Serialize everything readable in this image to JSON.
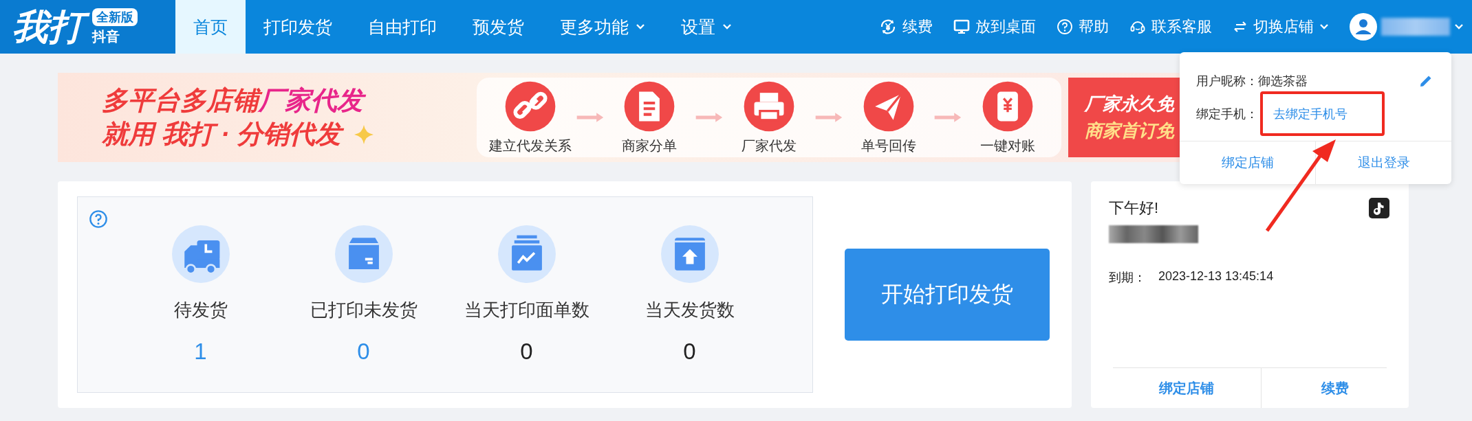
{
  "logo": {
    "title": "我打",
    "badge": "全新版",
    "subtitle": "抖音"
  },
  "nav": [
    {
      "label": "首页",
      "selected": true,
      "dropdown": false
    },
    {
      "label": "打印发货",
      "selected": false,
      "dropdown": false
    },
    {
      "label": "自由打印",
      "selected": false,
      "dropdown": false
    },
    {
      "label": "预发货",
      "selected": false,
      "dropdown": false
    },
    {
      "label": "更多功能",
      "selected": false,
      "dropdown": true
    },
    {
      "label": "设置",
      "selected": false,
      "dropdown": true
    }
  ],
  "toolbar": [
    {
      "label": "续费",
      "dropdown": false
    },
    {
      "label": "放到桌面",
      "dropdown": false
    },
    {
      "label": "帮助",
      "dropdown": false
    },
    {
      "label": "联系客服",
      "dropdown": false
    },
    {
      "label": "切换店铺",
      "dropdown": true
    }
  ],
  "banner": {
    "headline": [
      {
        "text": "多平台多店铺",
        "kind": "primary"
      },
      {
        "text": "厂家代发",
        "kind": "accent"
      }
    ],
    "tagline": "就用 我打 · 分销代发",
    "steps": [
      "建立代发关系",
      "商家分单",
      "厂家代发",
      "单号回传",
      "一键对账"
    ],
    "promo": [
      "厂家永久免",
      "商家首订免"
    ]
  },
  "stats": [
    {
      "label": "待发货",
      "value": "1",
      "kind": "link"
    },
    {
      "label": "已打印未发货",
      "value": "0",
      "kind": "link"
    },
    {
      "label": "当天打印面单数",
      "value": "0",
      "kind": "plain"
    },
    {
      "label": "当天发货数",
      "value": "0",
      "kind": "plain"
    }
  ],
  "start_button": "开始打印发货",
  "account_card": {
    "greeting": "下午好!",
    "expiry_label": "到期：",
    "expiry": "2023-12-13 13:45:14",
    "actions": [
      "绑定店铺",
      "续费"
    ]
  },
  "user_menu": {
    "nickname_label": "用户昵称：",
    "nickname": "御选茶器",
    "phone_label": "绑定手机：",
    "phone_link": "去绑定手机号",
    "actions": [
      "绑定店铺",
      "退出登录"
    ]
  },
  "annotation": {
    "kind": "callout"
  }
}
